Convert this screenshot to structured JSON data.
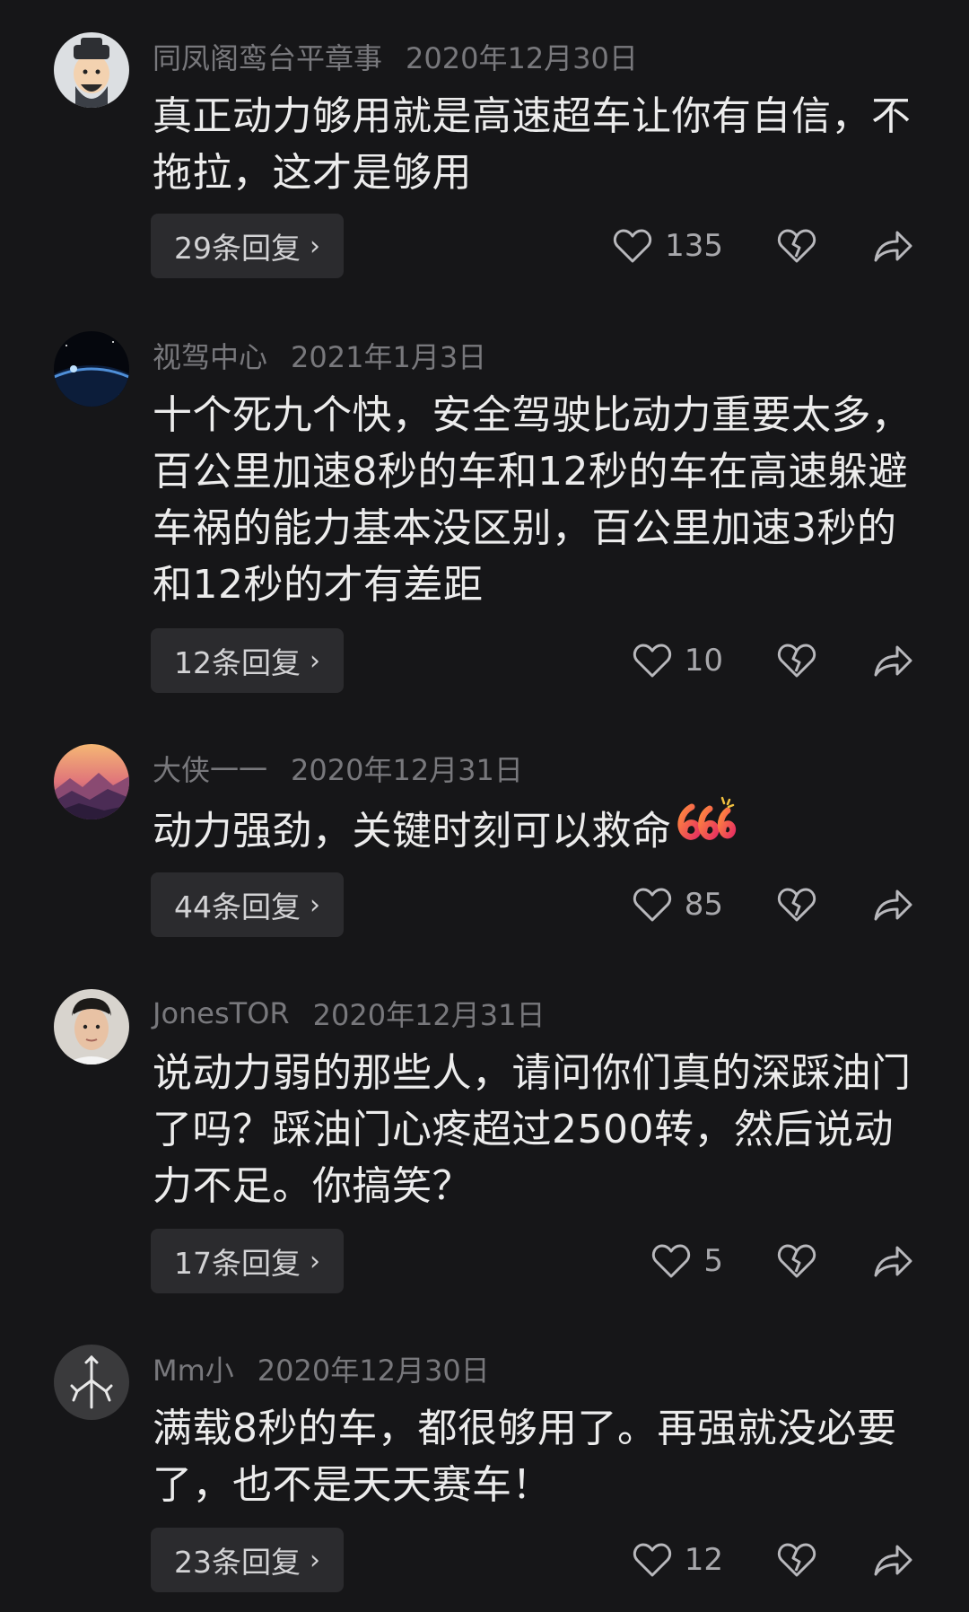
{
  "comments": [
    {
      "username": "同凤阁鸾台平章事",
      "date": "2020年12月30日",
      "text": "真正动力够用就是高速超车让你有自信，不拖拉，这才是够用",
      "replies": "29条回复",
      "likes": "135",
      "avatar_icon": "cartoon-scholar-avatar"
    },
    {
      "username": "视驾中心",
      "date": "2021年1月3日",
      "text": "十个死九个快，安全驾驶比动力重要太多，百公里加速8秒的车和12秒的车在高速躲避车祸的能力基本没区别，百公里加速3秒的和12秒的才有差距",
      "replies": "12条回复",
      "likes": "10",
      "avatar_icon": "earth-space-avatar"
    },
    {
      "username": "大侠一一",
      "date": "2020年12月31日",
      "text": "动力强劲，关键时刻可以救命",
      "replies": "44条回复",
      "likes": "85",
      "avatar_icon": "sunset-mountain-avatar",
      "emoji": "666-emoji"
    },
    {
      "username": "JonesTOR",
      "date": "2020年12月31日",
      "text": "说动力弱的那些人，请问你们真的深踩油门了吗？踩油门心疼超过2500转，然后说动力不足。你搞笑？",
      "replies": "17条回复",
      "likes": "5",
      "avatar_icon": "man-portrait-avatar"
    },
    {
      "username": "Mm小",
      "date": "2020年12月30日",
      "text": "满载8秒的车，都很够用了。再强就没必要了，也不是天天赛车！",
      "replies": "23条回复",
      "likes": "12",
      "avatar_icon": "tree-symbol-avatar"
    }
  ],
  "ui": {
    "chevron": "›"
  }
}
